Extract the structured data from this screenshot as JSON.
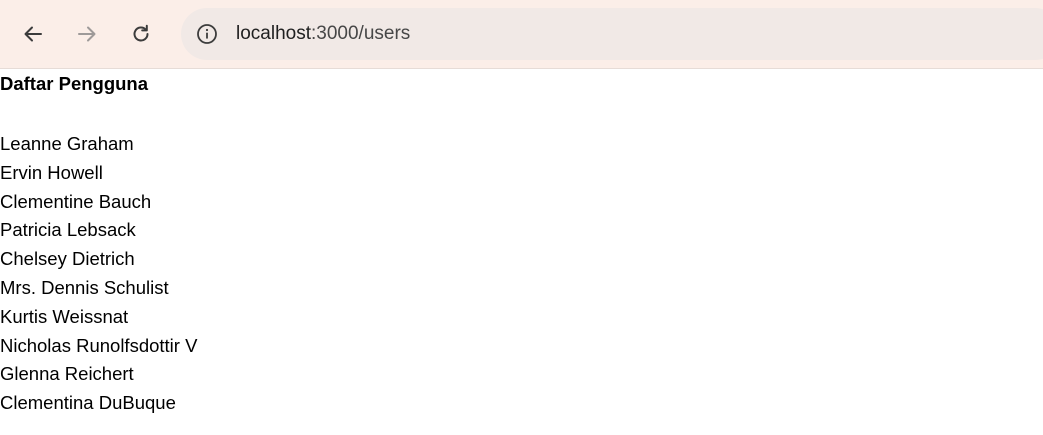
{
  "browser": {
    "url_host": "localhost",
    "url_path": ":3000/users",
    "icons": {
      "back": "arrow-left-icon",
      "forward": "arrow-right-icon",
      "reload": "reload-icon",
      "site_info": "info-circle-icon"
    }
  },
  "page": {
    "title": "Daftar Pengguna",
    "users": [
      "Leanne Graham",
      "Ervin Howell",
      "Clementine Bauch",
      "Patricia Lebsack",
      "Chelsey Dietrich",
      "Mrs. Dennis Schulist",
      "Kurtis Weissnat",
      "Nicholas Runolfsdottir V",
      "Glenna Reichert",
      "Clementina DuBuque"
    ]
  }
}
